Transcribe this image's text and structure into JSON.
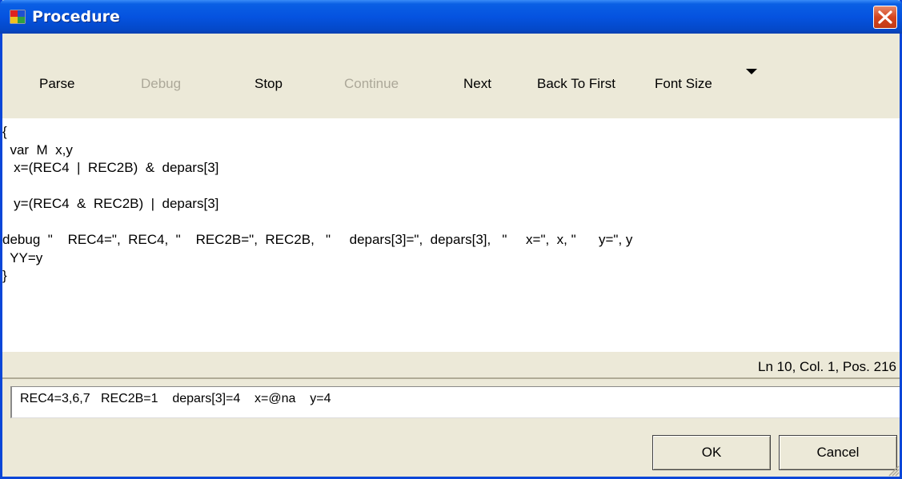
{
  "window": {
    "title": "Procedure"
  },
  "toolbar": {
    "items": [
      {
        "label": "Parse",
        "enabled": true
      },
      {
        "label": "Debug",
        "enabled": false
      },
      {
        "label": "Stop",
        "enabled": true
      },
      {
        "label": "Continue",
        "enabled": false
      },
      {
        "label": "Next",
        "enabled": true
      },
      {
        "label": "Back To First",
        "enabled": true
      },
      {
        "label": "Font Size",
        "enabled": true
      }
    ]
  },
  "editor": {
    "text": "{\n  var  M  x,y\n   x=(REC4  |  REC2B)  &  depars[3]\n\n   y=(REC4  &  REC2B)  |  depars[3]\n\ndebug  \"    REC4=\",  REC4,  \"    REC2B=\",  REC2B,   \"     depars[3]=\",  depars[3],   \"     x=\",  x, \"      y=\", y\n  YY=y\n}"
  },
  "status": {
    "position": "Ln 10, Col. 1, Pos. 216"
  },
  "output": {
    "text": "REC4=3,6,7   REC2B=1    depars[3]=4    x=@na    y=4"
  },
  "dialog": {
    "ok_label": "OK",
    "cancel_label": "Cancel"
  },
  "colors": {
    "titlebar": "#0553e0",
    "close": "#d4451f",
    "face": "#ece9d8",
    "disabled_text": "#aca899"
  },
  "icons": {
    "app": "procedure-app-icon",
    "close": "close-icon",
    "dropdown": "dropdown-arrow-icon",
    "grip": "resize-grip-icon"
  }
}
